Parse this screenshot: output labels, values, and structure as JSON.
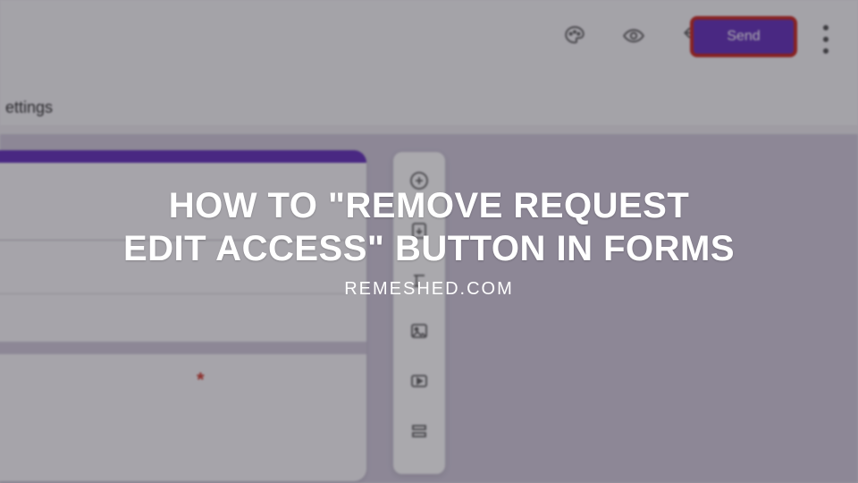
{
  "toolbar": {
    "send_label": "Send"
  },
  "tabs": {
    "settings_label": "ettings"
  },
  "form": {
    "required_indicator": "*"
  },
  "overlay": {
    "headline_line1": "HOW TO \"REMOVE REQUEST",
    "headline_line2": "EDIT ACCESS\" BUTTON IN FORMS",
    "source": "REMESHED.COM"
  }
}
